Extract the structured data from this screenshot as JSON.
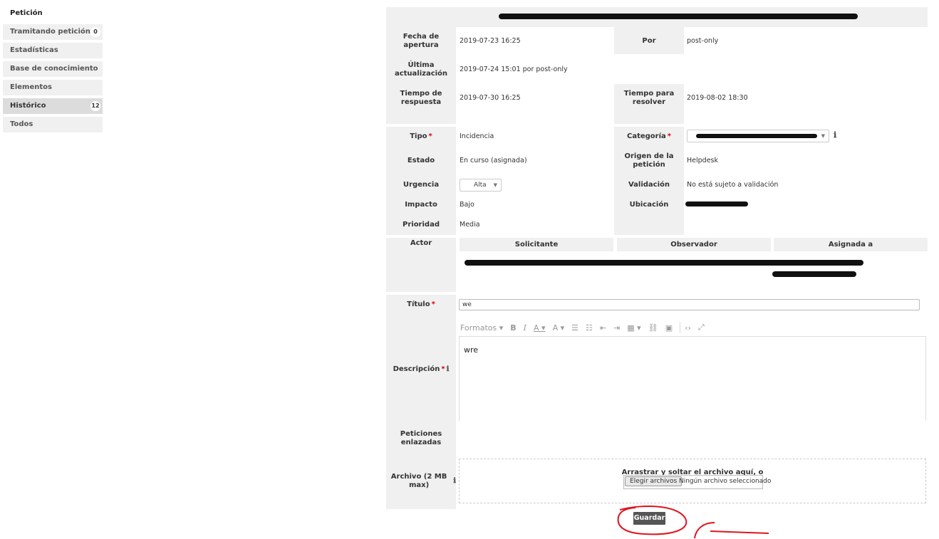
{
  "sidebar": {
    "heading": "Petición",
    "items": [
      {
        "label": "Tramitando petición",
        "badge": "0"
      },
      {
        "label": "Estadísticas"
      },
      {
        "label": "Base de conocimiento"
      },
      {
        "label": "Elementos"
      },
      {
        "label": "Histórico",
        "badge": "12"
      },
      {
        "label": "Todos"
      }
    ]
  },
  "dates": {
    "opening_label": "Fecha de apertura",
    "opening_value": "2019-07-23 16:25",
    "by_label": "Por",
    "by_value": "post-only",
    "last_update_label": "Última actualización",
    "last_update_value": "2019-07-24 15:01 por post-only",
    "response_label": "Tiempo de respuesta",
    "response_value": "2019-07-30 16:25",
    "resolve_label": "Tiempo para resolver",
    "resolve_value": "2019-08-02 18:30"
  },
  "fields": {
    "tipo_label": "Tipo",
    "tipo_value": "Incidencia",
    "categoria_label": "Categoría",
    "estado_label": "Estado",
    "estado_value": "En curso (asignada)",
    "origen_label": "Origen de la petición",
    "origen_value": "Helpdesk",
    "urgencia_label": "Urgencia",
    "urgencia_value": "Alta",
    "validacion_label": "Validación",
    "validacion_value": "No está sujeto a validación",
    "impacto_label": "Impacto",
    "impacto_value": "Bajo",
    "ubicacion_label": "Ubicación",
    "prioridad_label": "Prioridad",
    "prioridad_value": "Media"
  },
  "actors": {
    "label": "Actor",
    "solicitante": "Solicitante",
    "observador": "Observador",
    "asignada": "Asignada a"
  },
  "titulo": {
    "label": "Título",
    "value": "we"
  },
  "descripcion": {
    "label": "Descripción",
    "value": "wre",
    "formats_label": "Formatos"
  },
  "linked": {
    "label": "Peticiones enlazadas"
  },
  "archivo": {
    "label": "Archivo (2 MB max)",
    "drop_text": "Arrastrar y soltar el archivo aquí, o",
    "choose_label": "Elegir archivos",
    "status": "Ningún archivo seleccionado"
  },
  "save_label": "Guardar",
  "colors": {
    "panel": "#f0f0f0",
    "required": "#dd0000",
    "annotation": "#e0141e",
    "save_button": "#555555"
  }
}
